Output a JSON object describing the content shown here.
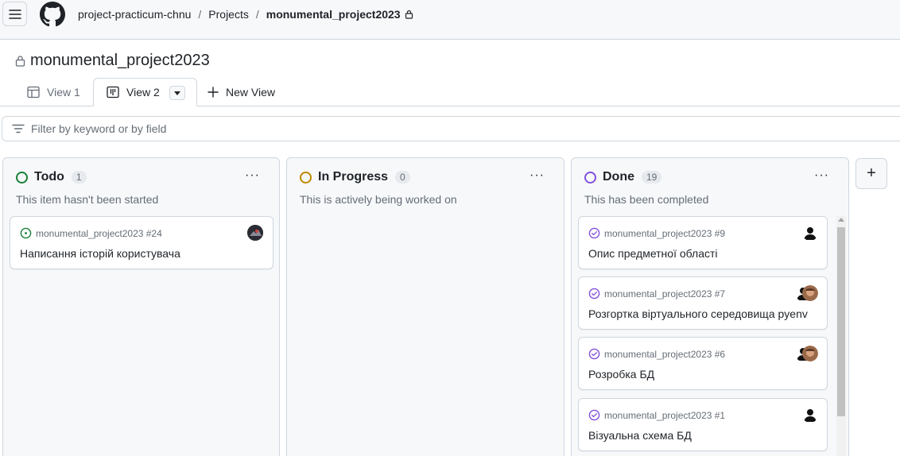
{
  "header": {
    "breadcrumbs": [
      "project-practicum-chnu",
      "Projects",
      "monumental_project2023"
    ],
    "separator": "/"
  },
  "project": {
    "title": "monumental_project2023"
  },
  "tabs": [
    {
      "label": "View 1"
    },
    {
      "label": "View 2"
    },
    {
      "label": "New View"
    }
  ],
  "filter": {
    "placeholder": "Filter by keyword or by field"
  },
  "columns": [
    {
      "name": "Todo",
      "count": "1",
      "description": "This item hasn't been started",
      "status_color": "#1a7f37",
      "cards": [
        {
          "repo": "monumental_project2023 #24",
          "title": "Написання історій користувача"
        }
      ]
    },
    {
      "name": "In Progress",
      "count": "0",
      "description": "This is actively being worked on",
      "status_color": "#bf8700",
      "cards": []
    },
    {
      "name": "Done",
      "count": "19",
      "description": "This has been completed",
      "status_color": "#8250df",
      "cards": [
        {
          "repo": "monumental_project2023 #9",
          "title": "Опис предметної області"
        },
        {
          "repo": "monumental_project2023 #7",
          "title": "Розгортка віртуального середовища pyenv"
        },
        {
          "repo": "monumental_project2023 #6",
          "title": "Розробка БД"
        },
        {
          "repo": "monumental_project2023 #1",
          "title": "Візуальна схема БД"
        }
      ]
    }
  ],
  "more_label": "···",
  "add_column_label": "+"
}
